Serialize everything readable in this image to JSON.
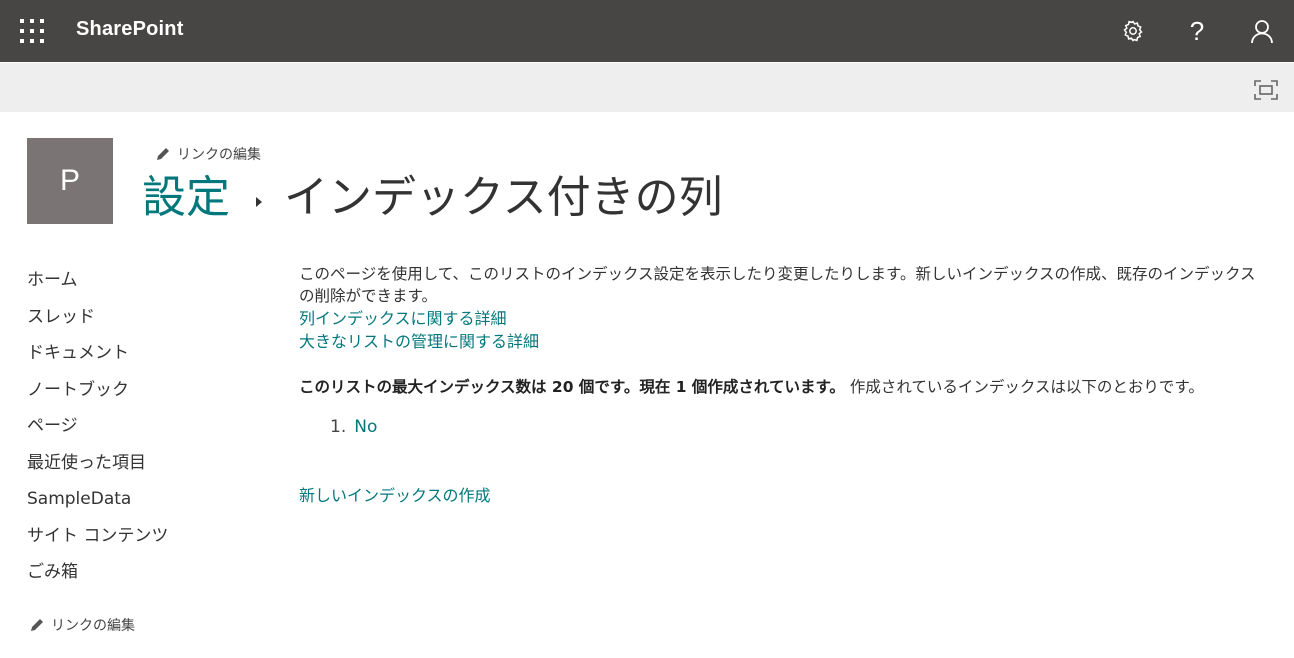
{
  "suite_bar": {
    "brand": "SharePoint",
    "help_label": "?",
    "icons": [
      "waffle-icon",
      "gear-icon",
      "help-icon",
      "user-icon"
    ],
    "background_color": "#484644"
  },
  "command_bar": {
    "icons": [
      "focus-mode-icon"
    ]
  },
  "site_header": {
    "logo_letter": "P",
    "logo_color": "#7a7574",
    "edit_links_label": "リンクの編集",
    "breadcrumb": [
      "設定",
      "インデックス付きの列"
    ]
  },
  "left_nav": {
    "items": [
      "ホーム",
      "スレッド",
      "ドキュメント",
      "ノートブック",
      "ページ",
      "最近使った項目",
      "SampleData",
      "サイト コンテンツ",
      "ごみ箱"
    ],
    "edit_links_label": "リンクの編集"
  },
  "main": {
    "description": "このページを使用して、このリストのインデックス設定を表示したり変更したりします。新しいインデックスの作成、既存のインデックスの削除ができます。",
    "learn_more_links": [
      "列インデックスに関する詳細",
      "大きなリストの管理に関する詳細"
    ],
    "summary_bold": "このリストの最大インデックス数は 20 個です。現在 1 個作成されています。",
    "summary_normal": "作成されているインデックスは以下のとおりです。",
    "indexes": [
      {
        "number": "1.",
        "name": "No"
      }
    ],
    "create_index_link": "新しいインデックスの作成",
    "link_color": "#03787c"
  }
}
